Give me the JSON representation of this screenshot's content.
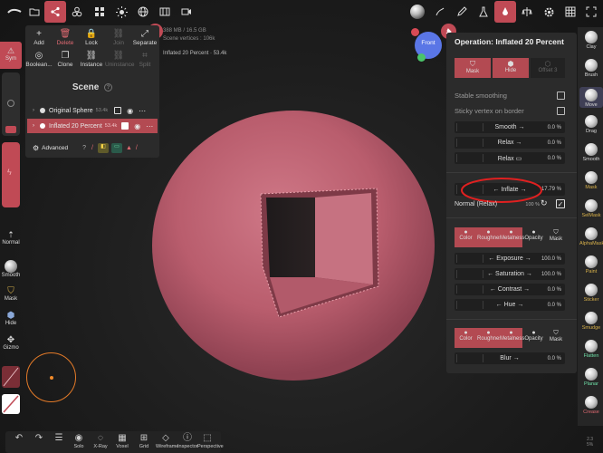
{
  "topbar": {
    "left_icons": [
      "app-logo-icon",
      "folder-icon",
      "share-nodes-icon",
      "spheres-icon",
      "grid-icon",
      "sun-icon",
      "globe-icon",
      "video-icon"
    ],
    "right_icons": [
      "material-sphere-icon",
      "stroke-icon",
      "pen-icon",
      "flask-icon",
      "dropper-icon",
      "settings-gear-icon",
      "scene-grid-icon",
      "fullscreen-icon"
    ]
  },
  "stats": {
    "memory": "388 MB / 16.5 GB",
    "vertices": "Scene vertices : 106k",
    "selected": "Inflated 20 Percent · 53.4k"
  },
  "scene_panel": {
    "tools_row1": [
      {
        "label": "Add",
        "icon": "+"
      },
      {
        "label": "Delete",
        "icon": "🗑"
      },
      {
        "label": "Lock",
        "icon": "🔒"
      },
      {
        "label": "Join",
        "icon": "⛓"
      },
      {
        "label": "Separate",
        "icon": "⤢"
      }
    ],
    "tools_row2": [
      {
        "label": "Boolean...",
        "icon": "◎"
      },
      {
        "label": "Clone",
        "icon": "❐"
      },
      {
        "label": "Instance",
        "icon": "⛓"
      },
      {
        "label": "Uninstance",
        "icon": "⛓"
      },
      {
        "label": "Split",
        "icon": "⌗"
      }
    ],
    "title": "Scene",
    "items": [
      {
        "name": "Original Sphere",
        "count": "53.4k"
      },
      {
        "name": "Inflated 20 Percent",
        "count": "53.4k"
      }
    ],
    "advanced_label": "Advanced"
  },
  "left_rail": {
    "sym_label": "Sym",
    "normal_label": "Normal",
    "smooth_label": "Smooth",
    "mask_label": "Mask",
    "hide_label": "Hide",
    "gizmo_label": "Gizmo"
  },
  "view_cube": {
    "label": "Front"
  },
  "operation_panel": {
    "title": "Operation: Inflated 20 Percent",
    "tabs": [
      {
        "label": "Mask",
        "on": true
      },
      {
        "label": "Hide",
        "on": true
      },
      {
        "label": "Offset 3",
        "on": false
      }
    ],
    "stable_smoothing": "Stable smoothing",
    "sticky_vertex": "Sticky vertex on border",
    "smooth_label": "Smooth →",
    "smooth_val": "0.0 %",
    "relax_label": "Relax →",
    "relax_val": "0.0 %",
    "relax2_label": "Relax ▭",
    "relax2_val": "0.0 %",
    "inflate_label": "← Inflate →",
    "inflate_val": "17.79 %",
    "normal_relax_label": "Normal (Relax)",
    "normal_relax_val": "100 %",
    "paint_tabs": [
      "Color",
      "Roughness",
      "Metalness",
      "Opacity",
      "Mask"
    ],
    "exposure_label": "← Exposure →",
    "exposure_val": "100.0 %",
    "saturation_label": "← Saturation →",
    "saturation_val": "100.0 %",
    "contrast_label": "← Contrast →",
    "contrast_val": "0.0 %",
    "hue_label": "← Hue →",
    "hue_val": "0.0 %",
    "blur_tabs": [
      "Color",
      "Roughness",
      "Metalness",
      "Opacity",
      "Mask"
    ],
    "blur_label": "Blur →",
    "blur_val": "0.0 %"
  },
  "right_tools": [
    "Clay",
    "Brush",
    "Move",
    "Drag",
    "Smooth",
    "Mask",
    "SelMask",
    "AlphaMask",
    "Paint",
    "Sticker",
    "Smudge",
    "Flatten",
    "Planar",
    "Crease"
  ],
  "version": "2.3\n5%",
  "bottombar": [
    {
      "label": "",
      "icon": "↶"
    },
    {
      "label": "",
      "icon": "↷"
    },
    {
      "label": "",
      "icon": "☰"
    },
    {
      "label": "Solo",
      "icon": "◉"
    },
    {
      "label": "X-Ray",
      "icon": "◌"
    },
    {
      "label": "Voxel",
      "icon": "▦"
    },
    {
      "label": "Grid",
      "icon": "⊞"
    },
    {
      "label": "Wireframe",
      "icon": "◇"
    },
    {
      "label": "Inspector",
      "icon": "ⓘ"
    },
    {
      "label": "Perspective",
      "icon": "⬚"
    }
  ],
  "colors": {
    "accent": "#c04a55",
    "model": "#c2687a",
    "panel": "#2b2b2b"
  }
}
